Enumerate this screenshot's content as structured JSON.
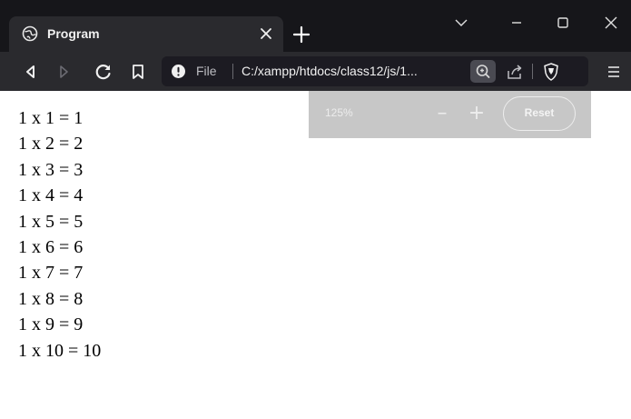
{
  "tab": {
    "title": "Program",
    "favicon": "globe-icon"
  },
  "toolbar": {
    "url_scheme_label": "File",
    "url": "C:/xampp/htdocs/class12/js/1..."
  },
  "zoom_popup": {
    "level": "125%",
    "reset_label": "Reset"
  },
  "content": {
    "lines": [
      "1 x 1 = 1",
      "1 x 2 = 2",
      "1 x 3 = 3",
      "1 x 4 = 4",
      "1 x 5 = 5",
      "1 x 6 = 6",
      "1 x 7 = 7",
      "1 x 8 = 8",
      "1 x 9 = 9",
      "1 x 10 = 10"
    ]
  },
  "colors": {
    "tabstrip_bg": "#16161a",
    "toolbar_bg": "#2a2a2e",
    "urlbar_bg": "#1c1b22",
    "popup_bg": "#c7c7c7"
  }
}
